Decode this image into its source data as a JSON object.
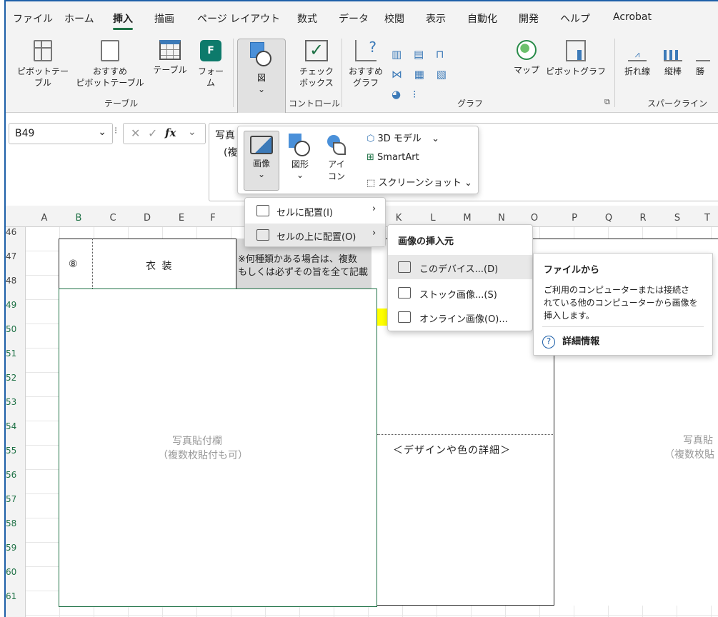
{
  "tabs": [
    "ファイル",
    "ホーム",
    "挿入",
    "描画",
    "ページ レイアウト",
    "数式",
    "データ",
    "校閲",
    "表示",
    "自動化",
    "開発",
    "ヘルプ",
    "Acrobat"
  ],
  "ribbon": {
    "pivot_table": "ピボットテー\nブル",
    "recommended_pivot": "おすすめ\nピボットテーブル",
    "table": "テーブル",
    "forms": "フォー\nム",
    "illustrations": "図",
    "checkbox": "チェック\nボックス",
    "recommended_charts": "おすすめ\nグラフ",
    "maps": "マップ",
    "pivot_chart": "ピボットグラフ",
    "line": "折れ線",
    "column": "縦棒",
    "winloss": "勝",
    "group_tables": "テーブル",
    "group_controls": "コントロール",
    "group_charts": "グラフ",
    "group_sparklines": "スパークライン"
  },
  "formula_bar": {
    "name_box": "B49",
    "fx": "fx",
    "content_line1": "写真",
    "content_line2": "(複"
  },
  "columns": [
    "A",
    "B",
    "C",
    "D",
    "E",
    "F",
    "K",
    "L",
    "M",
    "N",
    "O",
    "P",
    "Q",
    "R",
    "S",
    "T"
  ],
  "rows": [
    "46",
    "47",
    "48",
    "49",
    "50",
    "51",
    "52",
    "53",
    "54",
    "55",
    "56",
    "57",
    "58",
    "59",
    "60",
    "61"
  ],
  "sheet": {
    "num": "⑧",
    "costume": "衣 装",
    "note_line1": "※何種類かある場合は、複数",
    "note_line2": "もしくは必ずその旨を全て記載",
    "photo_line1": "写真貼付欄",
    "photo_line2": "（複数枚貼付も可）",
    "design": "＜デザインや色の詳細＞",
    "photo2_line1": "写真貼",
    "photo2_line2": "（複数枚貼"
  },
  "illust_menu": {
    "image": "画像",
    "shapes": "図形",
    "icons": "アイ\nコン",
    "model3d": "3D モデル",
    "smartart": "SmartArt",
    "screenshot": "スクリーンショット"
  },
  "image_menu": {
    "in_cell": "セルに配置(I)",
    "over_cells": "セルの上に配置(O)"
  },
  "insert_from": {
    "header": "画像の挿入元",
    "device": "このデバイス...(D)",
    "stock": "ストック画像...(S)",
    "online": "オンライン画像(O)..."
  },
  "tooltip": {
    "title": "ファイルから",
    "body_line1": "ご利用のコンピューターまたは接続さ",
    "body_line2": "れている他のコンピューターから画像を",
    "body_line3": "挿入します。",
    "more": "詳細情報"
  },
  "colors": {
    "accent": "#1e7145",
    "highlight": "#ffff00",
    "header_bg": "#f3f3f3"
  }
}
